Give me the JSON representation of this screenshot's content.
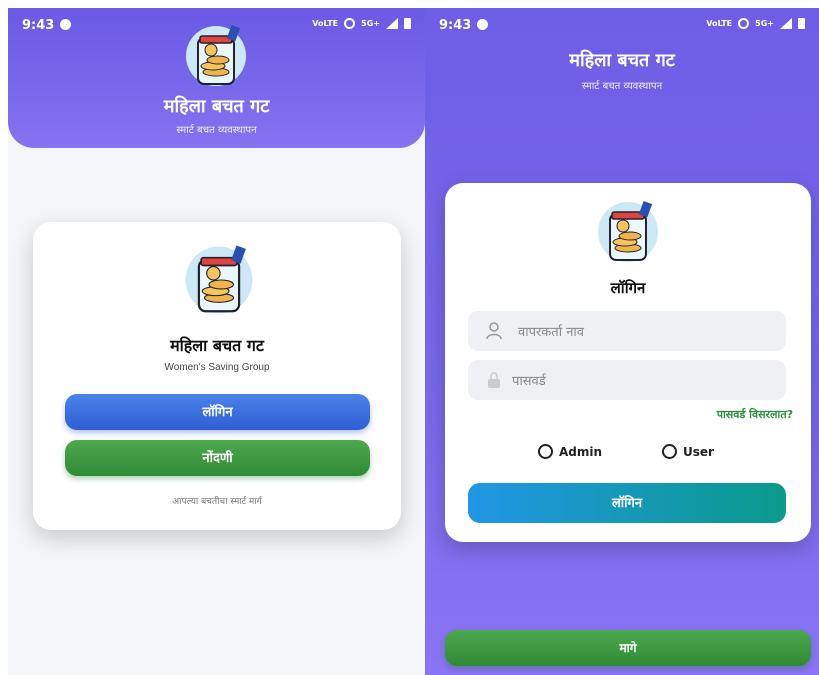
{
  "status": {
    "time": "9:43",
    "network": "5G+",
    "volte": "VoLTE"
  },
  "screen1": {
    "app_title": "महिला बचत गट",
    "app_subtitle": "स्मार्ट बचत व्यवस्थापन",
    "card_title": "महिला बचत गट",
    "card_subtitle": "Women's Saving Group",
    "login_button": "लॉगिन",
    "register_button": "नोंदणी",
    "tagline": "आपल्या बचतीचा स्मार्ट मार्ग"
  },
  "screen2": {
    "app_title": "महिला बचत गट",
    "app_subtitle": "स्मार्ट बचत व्यवस्थापन",
    "login_heading": "लॉगिन",
    "username_placeholder": "वापरकर्ता नाव",
    "password_placeholder": "पासवर्ड",
    "forgot_password": "पासवर्ड विसरलात?",
    "role_options": [
      "Admin",
      "User"
    ],
    "login_button": "लॉगिन",
    "back_button": "मागे"
  },
  "colors": {
    "purple": "#6e5ee6",
    "blue": "#2f5fd3",
    "green": "#2f8a34",
    "teal": "#0a9a8a"
  }
}
